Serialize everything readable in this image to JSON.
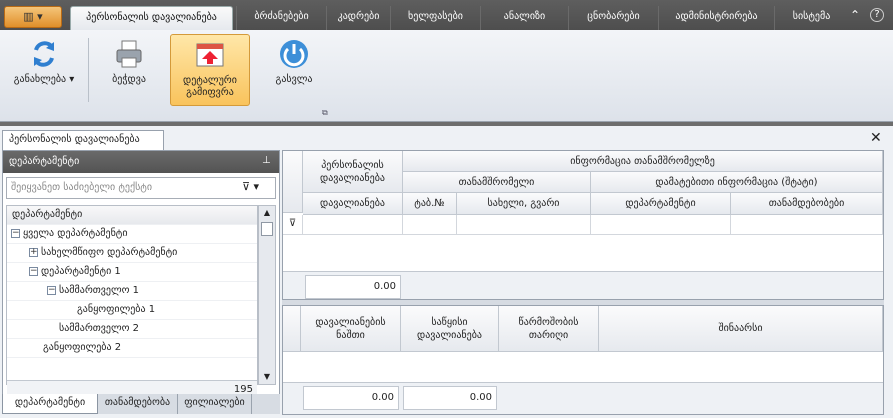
{
  "app_menu": {
    "label": "▥ ▾"
  },
  "ribbon_tabs": [
    {
      "label": "პერსონალის დავალიანება",
      "active": true
    },
    {
      "label": "ბრძანებები"
    },
    {
      "label": "კადრები"
    },
    {
      "label": "ხელფასები"
    },
    {
      "label": "ანალიზი"
    },
    {
      "label": "ცნობარები"
    },
    {
      "label": "ადმინისტრირება"
    },
    {
      "label": "სისტემა"
    }
  ],
  "collapse_glyph": "⌃",
  "ribbon_buttons": {
    "refresh": {
      "label": "განახლება ▾",
      "icon": "refresh-icon"
    },
    "print": {
      "label": "ბეჭდვა",
      "icon": "printer-icon"
    },
    "export": {
      "label": "დეტალური\nგამიფვრა",
      "icon": "export-icon"
    },
    "exit": {
      "label": "გასვლა",
      "icon": "power-icon"
    }
  },
  "doc_tab": {
    "label": "პერსონალის დავალიანება",
    "close": "✕"
  },
  "left_panel": {
    "header": "დეპარტამენტი",
    "pin": "⊥",
    "filter_placeholder": "შეიყვანეთ საძიებელი ტექსტი",
    "tree_header": "დეპარტამენტი",
    "nodes": [
      {
        "label": "ყველა დეპარტამენტი",
        "level": 0,
        "toggle": "−"
      },
      {
        "label": "სახელმწიფო დეპარტამენტი",
        "level": 1,
        "toggle": "+"
      },
      {
        "label": "დეპარტამენტი 1",
        "level": 1,
        "toggle": "−"
      },
      {
        "label": "სამმართველო 1",
        "level": 2,
        "toggle": "−"
      },
      {
        "label": "განყოფილება 1",
        "level": 3,
        "toggle": ""
      },
      {
        "label": "სამმართველო 2",
        "level": 2,
        "toggle": ""
      },
      {
        "label": "განყოფილება 2",
        "level": 1,
        "toggle": ""
      }
    ],
    "count": "195",
    "tabs": [
      "დეპარტამენტი",
      "თანამდებობა",
      "ფილიალები"
    ]
  },
  "grid1": {
    "col_personnel": "პერსონალის\nდავალიანება",
    "group_info": "ინფორმაცია თანამშრომელზე",
    "group_employee": "თანამშრომელი",
    "group_extra": "დამატებითი ინფორმაცია (შტატი)",
    "col_debt": "დავალიანება",
    "col_tabno": "ტაბ.№",
    "col_name": "სახელი, გვარი",
    "col_dept": "დეპარტამენტი",
    "col_position": "თანამდებობები",
    "filter_icon": "⊽",
    "total": "0.00"
  },
  "grid2": {
    "col_balance": "დავალიანების\nნაშთი",
    "col_initial": "საწყისი\nდავალიანება",
    "col_date": "წარმოშობის\nთარიღი",
    "col_content": "შინაარსი",
    "total1": "0.00",
    "total2": "0.00"
  }
}
